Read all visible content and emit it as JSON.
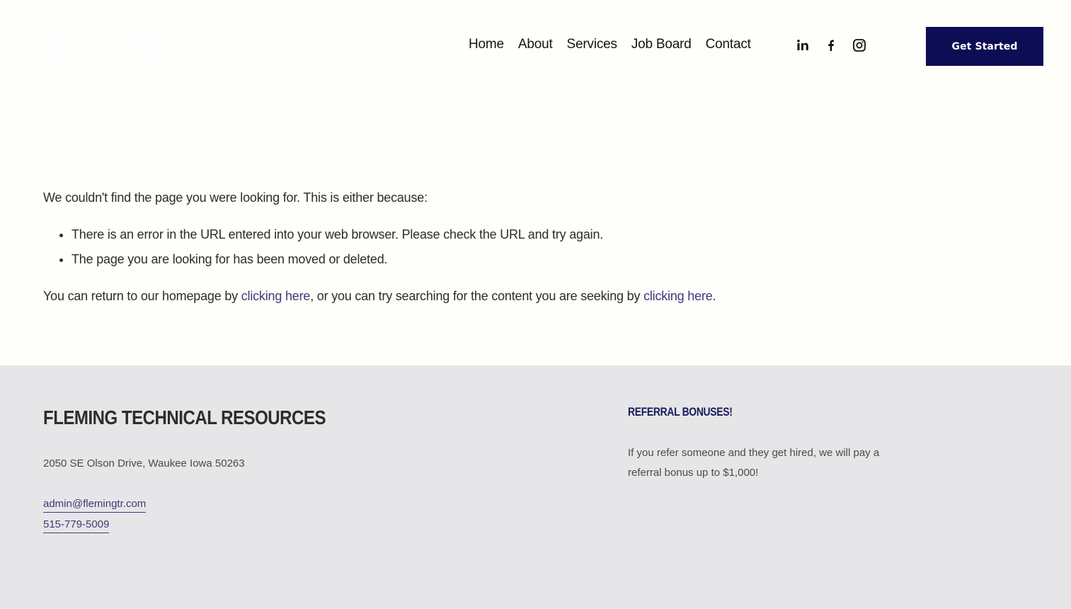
{
  "header": {
    "logo_alt": "Fleming Technical Resources logo",
    "nav": [
      "Home",
      "About",
      "Services",
      "Job Board",
      "Contact"
    ],
    "social": [
      {
        "name": "linkedin-icon",
        "glyph": "in"
      },
      {
        "name": "facebook-icon",
        "glyph": "f"
      },
      {
        "name": "instagram-icon",
        "glyph": "ig"
      }
    ],
    "cta_label": "Get Started"
  },
  "main": {
    "intro": "We couldn't find the page you were looking for. This is either because:",
    "reasons": [
      "There is an error in the URL entered into your web browser. Please check the URL and try again.",
      "The page you are looking for has been moved or deleted."
    ],
    "return_prefix": "You can return to our homepage by ",
    "link_1": "clicking here",
    "return_middle": ", or you can try searching for the content you are seeking by ",
    "link_2": "clicking here",
    "return_suffix": "."
  },
  "footer": {
    "brand": "FLEMING TECHNICAL RESOURCES",
    "address": "2050 SE Olson Drive, Waukee Iowa 50263",
    "email": "admin@flemingtr.com",
    "phone": "515-779-5009",
    "referral_title": "REFERRAL BONUSES!",
    "referral_text": "If you refer someone and they get hired, we will pay a referral bonus up to $1,000!"
  },
  "colors": {
    "page_bg": "#fefefb",
    "footer_bg": "#e6e6e8",
    "accent": "#0d0d55",
    "link": "#3b3b78"
  }
}
